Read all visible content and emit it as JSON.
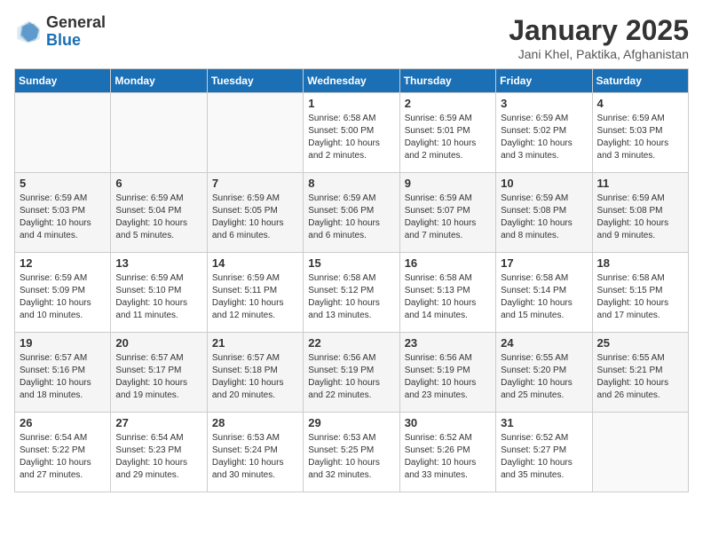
{
  "header": {
    "logo_general": "General",
    "logo_blue": "Blue",
    "title": "January 2025",
    "subtitle": "Jani Khel, Paktika, Afghanistan"
  },
  "days_of_week": [
    "Sunday",
    "Monday",
    "Tuesday",
    "Wednesday",
    "Thursday",
    "Friday",
    "Saturday"
  ],
  "weeks": [
    [
      {
        "day": "",
        "info": ""
      },
      {
        "day": "",
        "info": ""
      },
      {
        "day": "",
        "info": ""
      },
      {
        "day": "1",
        "info": "Sunrise: 6:58 AM\nSunset: 5:00 PM\nDaylight: 10 hours\nand 2 minutes."
      },
      {
        "day": "2",
        "info": "Sunrise: 6:59 AM\nSunset: 5:01 PM\nDaylight: 10 hours\nand 2 minutes."
      },
      {
        "day": "3",
        "info": "Sunrise: 6:59 AM\nSunset: 5:02 PM\nDaylight: 10 hours\nand 3 minutes."
      },
      {
        "day": "4",
        "info": "Sunrise: 6:59 AM\nSunset: 5:03 PM\nDaylight: 10 hours\nand 3 minutes."
      }
    ],
    [
      {
        "day": "5",
        "info": "Sunrise: 6:59 AM\nSunset: 5:03 PM\nDaylight: 10 hours\nand 4 minutes."
      },
      {
        "day": "6",
        "info": "Sunrise: 6:59 AM\nSunset: 5:04 PM\nDaylight: 10 hours\nand 5 minutes."
      },
      {
        "day": "7",
        "info": "Sunrise: 6:59 AM\nSunset: 5:05 PM\nDaylight: 10 hours\nand 6 minutes."
      },
      {
        "day": "8",
        "info": "Sunrise: 6:59 AM\nSunset: 5:06 PM\nDaylight: 10 hours\nand 6 minutes."
      },
      {
        "day": "9",
        "info": "Sunrise: 6:59 AM\nSunset: 5:07 PM\nDaylight: 10 hours\nand 7 minutes."
      },
      {
        "day": "10",
        "info": "Sunrise: 6:59 AM\nSunset: 5:08 PM\nDaylight: 10 hours\nand 8 minutes."
      },
      {
        "day": "11",
        "info": "Sunrise: 6:59 AM\nSunset: 5:08 PM\nDaylight: 10 hours\nand 9 minutes."
      }
    ],
    [
      {
        "day": "12",
        "info": "Sunrise: 6:59 AM\nSunset: 5:09 PM\nDaylight: 10 hours\nand 10 minutes."
      },
      {
        "day": "13",
        "info": "Sunrise: 6:59 AM\nSunset: 5:10 PM\nDaylight: 10 hours\nand 11 minutes."
      },
      {
        "day": "14",
        "info": "Sunrise: 6:59 AM\nSunset: 5:11 PM\nDaylight: 10 hours\nand 12 minutes."
      },
      {
        "day": "15",
        "info": "Sunrise: 6:58 AM\nSunset: 5:12 PM\nDaylight: 10 hours\nand 13 minutes."
      },
      {
        "day": "16",
        "info": "Sunrise: 6:58 AM\nSunset: 5:13 PM\nDaylight: 10 hours\nand 14 minutes."
      },
      {
        "day": "17",
        "info": "Sunrise: 6:58 AM\nSunset: 5:14 PM\nDaylight: 10 hours\nand 15 minutes."
      },
      {
        "day": "18",
        "info": "Sunrise: 6:58 AM\nSunset: 5:15 PM\nDaylight: 10 hours\nand 17 minutes."
      }
    ],
    [
      {
        "day": "19",
        "info": "Sunrise: 6:57 AM\nSunset: 5:16 PM\nDaylight: 10 hours\nand 18 minutes."
      },
      {
        "day": "20",
        "info": "Sunrise: 6:57 AM\nSunset: 5:17 PM\nDaylight: 10 hours\nand 19 minutes."
      },
      {
        "day": "21",
        "info": "Sunrise: 6:57 AM\nSunset: 5:18 PM\nDaylight: 10 hours\nand 20 minutes."
      },
      {
        "day": "22",
        "info": "Sunrise: 6:56 AM\nSunset: 5:19 PM\nDaylight: 10 hours\nand 22 minutes."
      },
      {
        "day": "23",
        "info": "Sunrise: 6:56 AM\nSunset: 5:19 PM\nDaylight: 10 hours\nand 23 minutes."
      },
      {
        "day": "24",
        "info": "Sunrise: 6:55 AM\nSunset: 5:20 PM\nDaylight: 10 hours\nand 25 minutes."
      },
      {
        "day": "25",
        "info": "Sunrise: 6:55 AM\nSunset: 5:21 PM\nDaylight: 10 hours\nand 26 minutes."
      }
    ],
    [
      {
        "day": "26",
        "info": "Sunrise: 6:54 AM\nSunset: 5:22 PM\nDaylight: 10 hours\nand 27 minutes."
      },
      {
        "day": "27",
        "info": "Sunrise: 6:54 AM\nSunset: 5:23 PM\nDaylight: 10 hours\nand 29 minutes."
      },
      {
        "day": "28",
        "info": "Sunrise: 6:53 AM\nSunset: 5:24 PM\nDaylight: 10 hours\nand 30 minutes."
      },
      {
        "day": "29",
        "info": "Sunrise: 6:53 AM\nSunset: 5:25 PM\nDaylight: 10 hours\nand 32 minutes."
      },
      {
        "day": "30",
        "info": "Sunrise: 6:52 AM\nSunset: 5:26 PM\nDaylight: 10 hours\nand 33 minutes."
      },
      {
        "day": "31",
        "info": "Sunrise: 6:52 AM\nSunset: 5:27 PM\nDaylight: 10 hours\nand 35 minutes."
      },
      {
        "day": "",
        "info": ""
      }
    ]
  ]
}
